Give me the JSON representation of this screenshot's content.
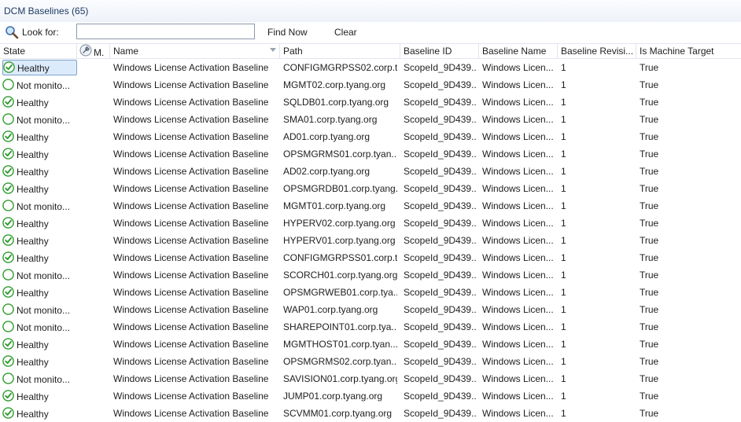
{
  "window": {
    "title": "DCM Baselines (65)"
  },
  "search": {
    "label": "Look for:",
    "value": "",
    "find_now": "Find Now",
    "clear": "Clear"
  },
  "columns": [
    "State",
    "M.",
    "Name",
    "Path",
    "Baseline ID",
    "Baseline Name",
    "Baseline Revisi...",
    "Is Machine Target"
  ],
  "colors": {
    "healthy": "#2e9b2e",
    "selection": "#dcebfc",
    "title": "#1c3a63"
  },
  "rows": [
    {
      "state": "Healthy",
      "status": "healthy",
      "name": "Windows License Activation Baseline",
      "path": "CONFIGMGRPSS02.corp.t...",
      "baseline_id": "ScopeId_9D439...",
      "baseline_name": "Windows Licen...",
      "revision": "1",
      "machine_target": "True"
    },
    {
      "state": "Not monito...",
      "status": "unmonitored",
      "name": "Windows License Activation Baseline",
      "path": "MGMT02.corp.tyang.org",
      "baseline_id": "ScopeId_9D439...",
      "baseline_name": "Windows Licen...",
      "revision": "1",
      "machine_target": "True"
    },
    {
      "state": "Healthy",
      "status": "healthy",
      "name": "Windows License Activation Baseline",
      "path": "SQLDB01.corp.tyang.org",
      "baseline_id": "ScopeId_9D439...",
      "baseline_name": "Windows Licen...",
      "revision": "1",
      "machine_target": "True"
    },
    {
      "state": "Not monito...",
      "status": "unmonitored",
      "name": "Windows License Activation Baseline",
      "path": "SMA01.corp.tyang.org",
      "baseline_id": "ScopeId_9D439...",
      "baseline_name": "Windows Licen...",
      "revision": "1",
      "machine_target": "True"
    },
    {
      "state": "Healthy",
      "status": "healthy",
      "name": "Windows License Activation Baseline",
      "path": "AD01.corp.tyang.org",
      "baseline_id": "ScopeId_9D439...",
      "baseline_name": "Windows Licen...",
      "revision": "1",
      "machine_target": "True"
    },
    {
      "state": "Healthy",
      "status": "healthy",
      "name": "Windows License Activation Baseline",
      "path": "OPSMGRMS01.corp.tyan...",
      "baseline_id": "ScopeId_9D439...",
      "baseline_name": "Windows Licen...",
      "revision": "1",
      "machine_target": "True"
    },
    {
      "state": "Healthy",
      "status": "healthy",
      "name": "Windows License Activation Baseline",
      "path": "AD02.corp.tyang.org",
      "baseline_id": "ScopeId_9D439...",
      "baseline_name": "Windows Licen...",
      "revision": "1",
      "machine_target": "True"
    },
    {
      "state": "Healthy",
      "status": "healthy",
      "name": "Windows License Activation Baseline",
      "path": "OPSMGRDB01.corp.tyang...",
      "baseline_id": "ScopeId_9D439...",
      "baseline_name": "Windows Licen...",
      "revision": "1",
      "machine_target": "True"
    },
    {
      "state": "Not monito...",
      "status": "unmonitored",
      "name": "Windows License Activation Baseline",
      "path": "MGMT01.corp.tyang.org",
      "baseline_id": "ScopeId_9D439...",
      "baseline_name": "Windows Licen...",
      "revision": "1",
      "machine_target": "True"
    },
    {
      "state": "Healthy",
      "status": "healthy",
      "name": "Windows License Activation Baseline",
      "path": "HYPERV02.corp.tyang.org",
      "baseline_id": "ScopeId_9D439...",
      "baseline_name": "Windows Licen...",
      "revision": "1",
      "machine_target": "True"
    },
    {
      "state": "Healthy",
      "status": "healthy",
      "name": "Windows License Activation Baseline",
      "path": "HYPERV01.corp.tyang.org",
      "baseline_id": "ScopeId_9D439...",
      "baseline_name": "Windows Licen...",
      "revision": "1",
      "machine_target": "True"
    },
    {
      "state": "Healthy",
      "status": "healthy",
      "name": "Windows License Activation Baseline",
      "path": "CONFIGMGRPSS01.corp.t...",
      "baseline_id": "ScopeId_9D439...",
      "baseline_name": "Windows Licen...",
      "revision": "1",
      "machine_target": "True"
    },
    {
      "state": "Not monito...",
      "status": "unmonitored",
      "name": "Windows License Activation Baseline",
      "path": "SCORCH01.corp.tyang.org",
      "baseline_id": "ScopeId_9D439...",
      "baseline_name": "Windows Licen...",
      "revision": "1",
      "machine_target": "True"
    },
    {
      "state": "Healthy",
      "status": "healthy",
      "name": "Windows License Activation Baseline",
      "path": "OPSMGRWEB01.corp.tya...",
      "baseline_id": "ScopeId_9D439...",
      "baseline_name": "Windows Licen...",
      "revision": "1",
      "machine_target": "True"
    },
    {
      "state": "Not monito...",
      "status": "unmonitored",
      "name": "Windows License Activation Baseline",
      "path": "WAP01.corp.tyang.org",
      "baseline_id": "ScopeId_9D439...",
      "baseline_name": "Windows Licen...",
      "revision": "1",
      "machine_target": "True"
    },
    {
      "state": "Not monito...",
      "status": "unmonitored",
      "name": "Windows License Activation Baseline",
      "path": "SHAREPOINT01.corp.tya...",
      "baseline_id": "ScopeId_9D439...",
      "baseline_name": "Windows Licen...",
      "revision": "1",
      "machine_target": "True"
    },
    {
      "state": "Healthy",
      "status": "healthy",
      "name": "Windows License Activation Baseline",
      "path": "MGMTHOST01.corp.tyan...",
      "baseline_id": "ScopeId_9D439...",
      "baseline_name": "Windows Licen...",
      "revision": "1",
      "machine_target": "True"
    },
    {
      "state": "Healthy",
      "status": "healthy",
      "name": "Windows License Activation Baseline",
      "path": "OPSMGRMS02.corp.tyan...",
      "baseline_id": "ScopeId_9D439...",
      "baseline_name": "Windows Licen...",
      "revision": "1",
      "machine_target": "True"
    },
    {
      "state": "Not monito...",
      "status": "unmonitored",
      "name": "Windows License Activation Baseline",
      "path": "SAVISION01.corp.tyang.org",
      "baseline_id": "ScopeId_9D439...",
      "baseline_name": "Windows Licen...",
      "revision": "1",
      "machine_target": "True"
    },
    {
      "state": "Healthy",
      "status": "healthy",
      "name": "Windows License Activation Baseline",
      "path": "JUMP01.corp.tyang.org",
      "baseline_id": "ScopeId_9D439...",
      "baseline_name": "Windows Licen...",
      "revision": "1",
      "machine_target": "True"
    },
    {
      "state": "Healthy",
      "status": "healthy",
      "name": "Windows License Activation Baseline",
      "path": "SCVMM01.corp.tyang.org",
      "baseline_id": "ScopeId_9D439...",
      "baseline_name": "Windows Licen...",
      "revision": "1",
      "machine_target": "True"
    }
  ]
}
